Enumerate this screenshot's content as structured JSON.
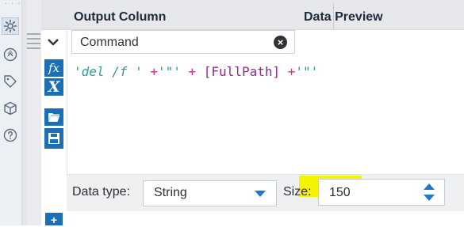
{
  "header": {
    "output_column": "Output Column",
    "data_preview": "Data Preview"
  },
  "row": {
    "command_value": "Command"
  },
  "expression": {
    "parts": [
      {
        "text": "'del /f '",
        "kind": "str"
      },
      {
        "text": " +",
        "kind": "op"
      },
      {
        "text": "'\"'",
        "kind": "str"
      },
      {
        "text": " + ",
        "kind": "op"
      },
      {
        "text": "[FullPath]",
        "kind": "fld"
      },
      {
        "text": " +",
        "kind": "op"
      },
      {
        "text": "'\"'",
        "kind": "str"
      }
    ]
  },
  "toolbar": {
    "fx_label": "fx",
    "variable_label": "X"
  },
  "bottom": {
    "data_type_label": "Data type:",
    "data_type_value": "String",
    "size_label": "Size:",
    "size_value": "150"
  },
  "rail_icons": [
    "gear-icon",
    "annotation-icon",
    "tag-icon",
    "cube-icon",
    "help-icon"
  ],
  "colors": {
    "accent_blue": "#1d6fb5",
    "highlight": "#f4f400",
    "string_color": "#2f9a92",
    "operator_color": "#cc2f8c",
    "field_color": "#8b2b8f"
  },
  "footer": {
    "add_label": "+"
  }
}
